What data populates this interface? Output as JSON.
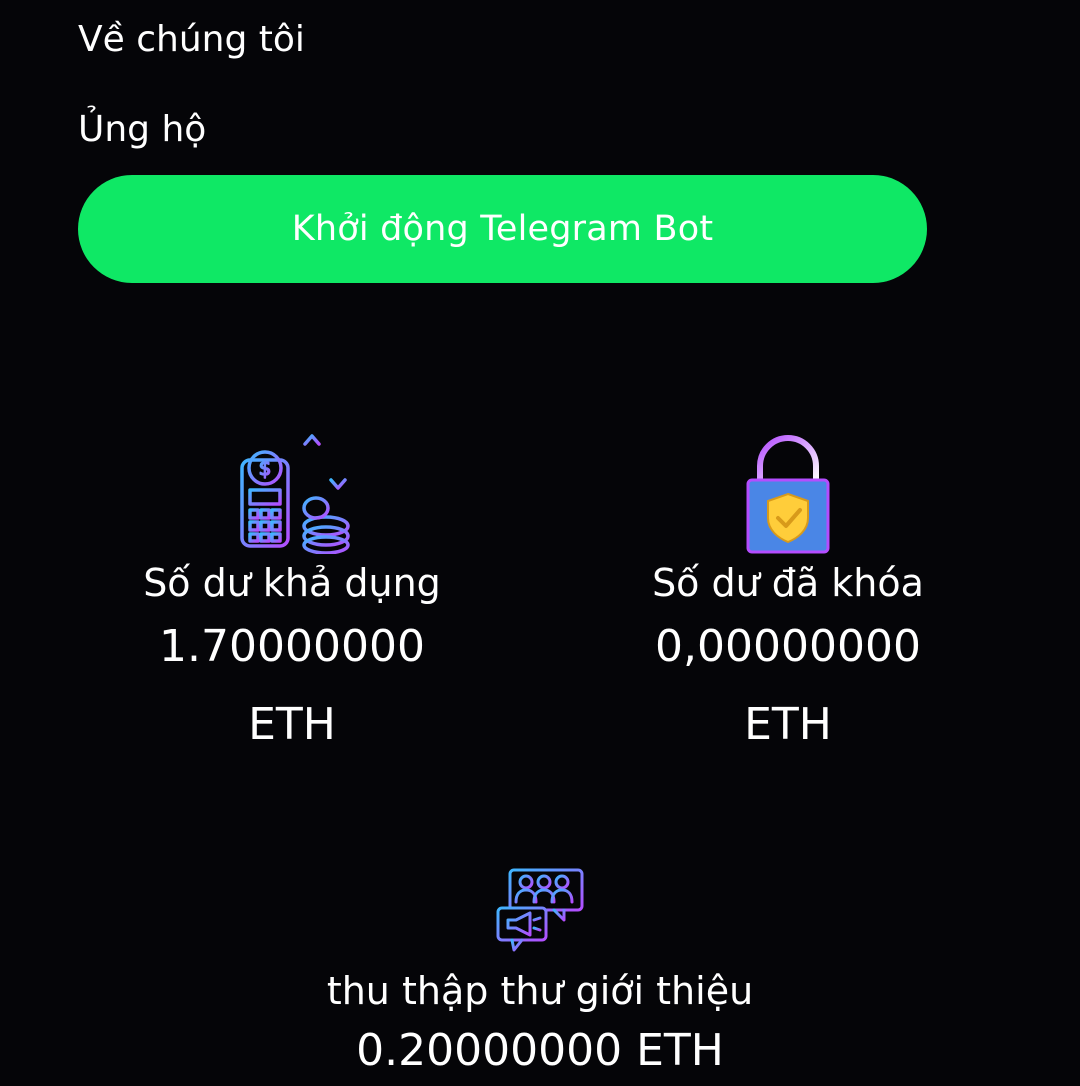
{
  "menu": {
    "about": "Về chúng tôi",
    "support": "Ủng hộ"
  },
  "bot_button": {
    "label": "Khởi động Telegram Bot",
    "color": "#0fe865"
  },
  "stats": {
    "available": {
      "label": "Số dư khả dụng",
      "amount": "1.70000000",
      "unit": "ETH",
      "icon": "payment-terminal-icon"
    },
    "locked": {
      "label": "Số dư đã khóa",
      "amount": "0,00000000",
      "unit": "ETH",
      "icon": "lock-shield-icon"
    },
    "referral": {
      "label": "thu thập thư giới thiệu",
      "amount": "0.20000000 ETH",
      "icon": "referral-group-icon"
    }
  },
  "colors": {
    "background": "#050508",
    "icon_gradient_start": "#3fb6ff",
    "icon_gradient_end": "#b44dff"
  }
}
